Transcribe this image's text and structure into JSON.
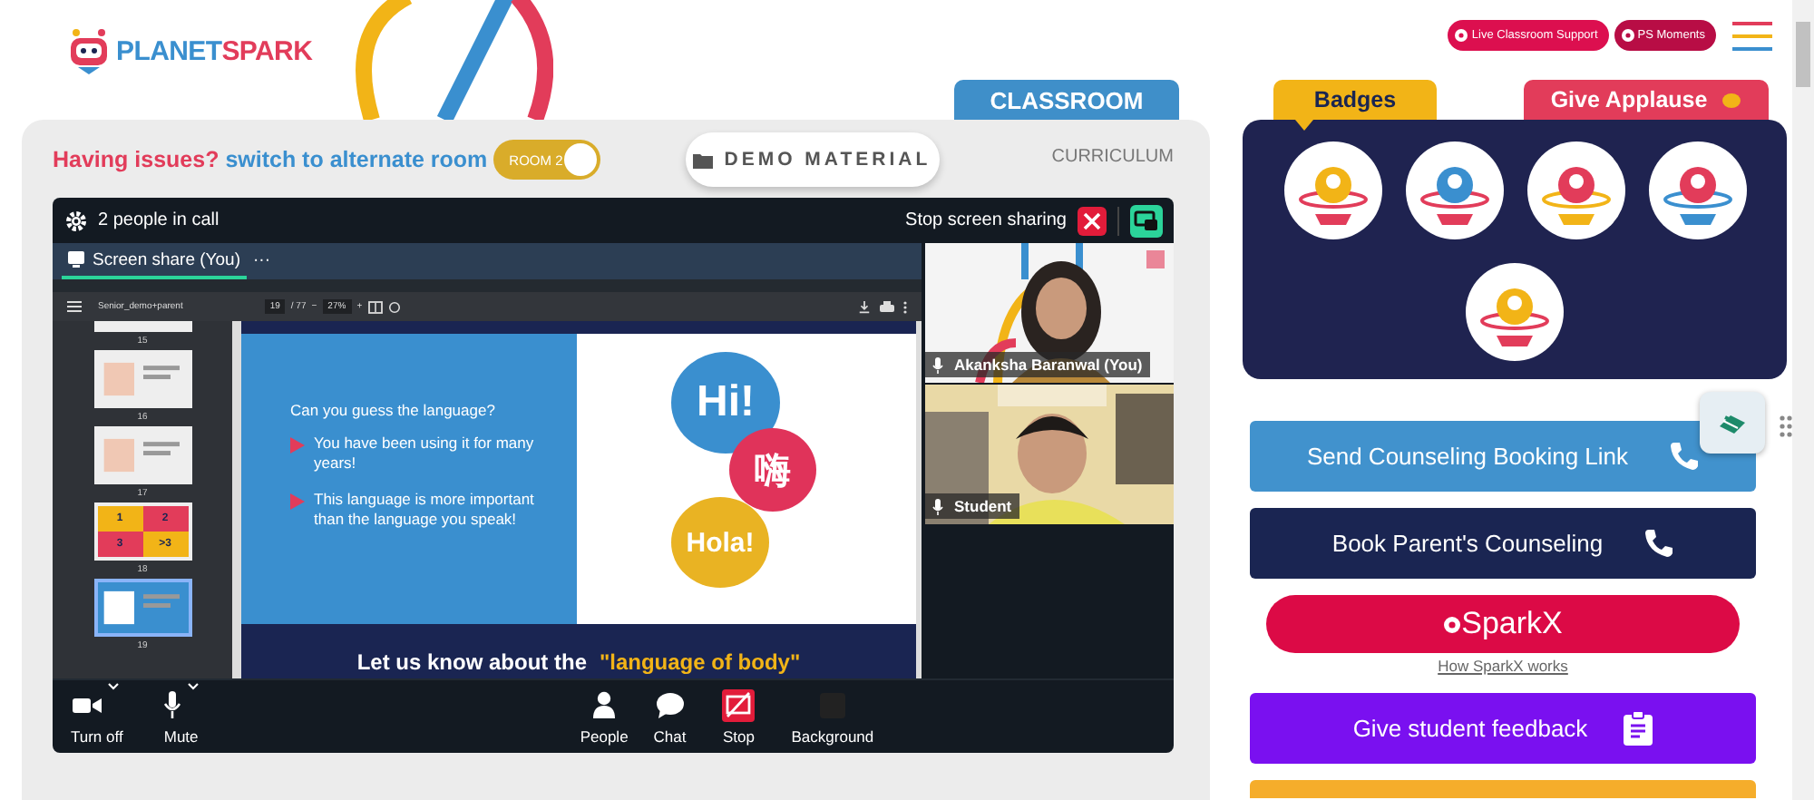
{
  "logo": {
    "first": "PLANET",
    "second": "SPARK"
  },
  "view_tabs": [
    {
      "label": "CLASSROOM",
      "selected": true
    },
    {
      "label": "CURRICULUM",
      "selected": false
    }
  ],
  "notice": {
    "problem": "Having issues?",
    "action": "switch to alternate room"
  },
  "room_toggle": {
    "label": "ROOM 2",
    "on": true
  },
  "demo_button": "DEMO MATERIAL",
  "call": {
    "people": "2 people in call",
    "stop_sharing": "Stop screen sharing",
    "share_tab": "Screen share (You)",
    "share_menu": "···"
  },
  "pdf": {
    "file": "Senior_demo+parent",
    "page": "19",
    "total": "/ 77",
    "zoom_out": "−",
    "zoom": "27%",
    "zoom_in": "+"
  },
  "thumbnails": [
    {
      "page": "15",
      "selected": false
    },
    {
      "page": "16",
      "selected": false
    },
    {
      "page": "17",
      "selected": false
    },
    {
      "page": "18",
      "selected": false,
      "cells": [
        "1",
        "2",
        "3",
        ">3"
      ]
    },
    {
      "page": "19",
      "selected": true
    }
  ],
  "slide": {
    "question": "Can you guess the language?",
    "bullets": [
      "You have been using it for many years!",
      "This language is more important than the language you speak!"
    ],
    "bubbles": [
      {
        "text": "Hi!",
        "color": "#3a8fcf"
      },
      {
        "text": "嗨",
        "color": "#e0335a"
      },
      {
        "text": "Hola!",
        "color": "#e9b323"
      }
    ],
    "banner": "Let us know about the ",
    "banner_highlight": "\"language of body\""
  },
  "participants": [
    {
      "name": "Akanksha Baranwal (You)"
    },
    {
      "name": "Student"
    }
  ],
  "controls": [
    {
      "label": "Turn off",
      "kind": "camera",
      "menu": true
    },
    {
      "label": "Mute",
      "kind": "mic",
      "menu": true
    },
    {
      "label": "People",
      "kind": "people",
      "menu": false
    },
    {
      "label": "Chat",
      "kind": "chat",
      "menu": false
    },
    {
      "label": "Stop",
      "kind": "stop",
      "menu": false
    },
    {
      "label": "Background",
      "kind": "background",
      "menu": false
    }
  ],
  "top_links": [
    {
      "label": "Live Classroom Support",
      "color": "#dc0f4f"
    },
    {
      "label": "PS Moments",
      "color": "#b80d45"
    }
  ],
  "panel_tabs": [
    {
      "label": "Badges",
      "selected": true,
      "color": "#f2b417"
    },
    {
      "label": "Give Applause",
      "selected": false,
      "color": "#e23c5a"
    }
  ],
  "actions": [
    {
      "label": "Send Counseling Booking Link",
      "kind": "phone",
      "color": "#4192cd"
    },
    {
      "label": "Book Parent's Counseling",
      "kind": "phone",
      "color": "#1a2552"
    }
  ],
  "sparkx": {
    "label": "SparkX",
    "link": "How SparkX works"
  },
  "feedback": {
    "label": "Give student feedback",
    "kind": "clipboard",
    "color": "#7a10f0"
  }
}
